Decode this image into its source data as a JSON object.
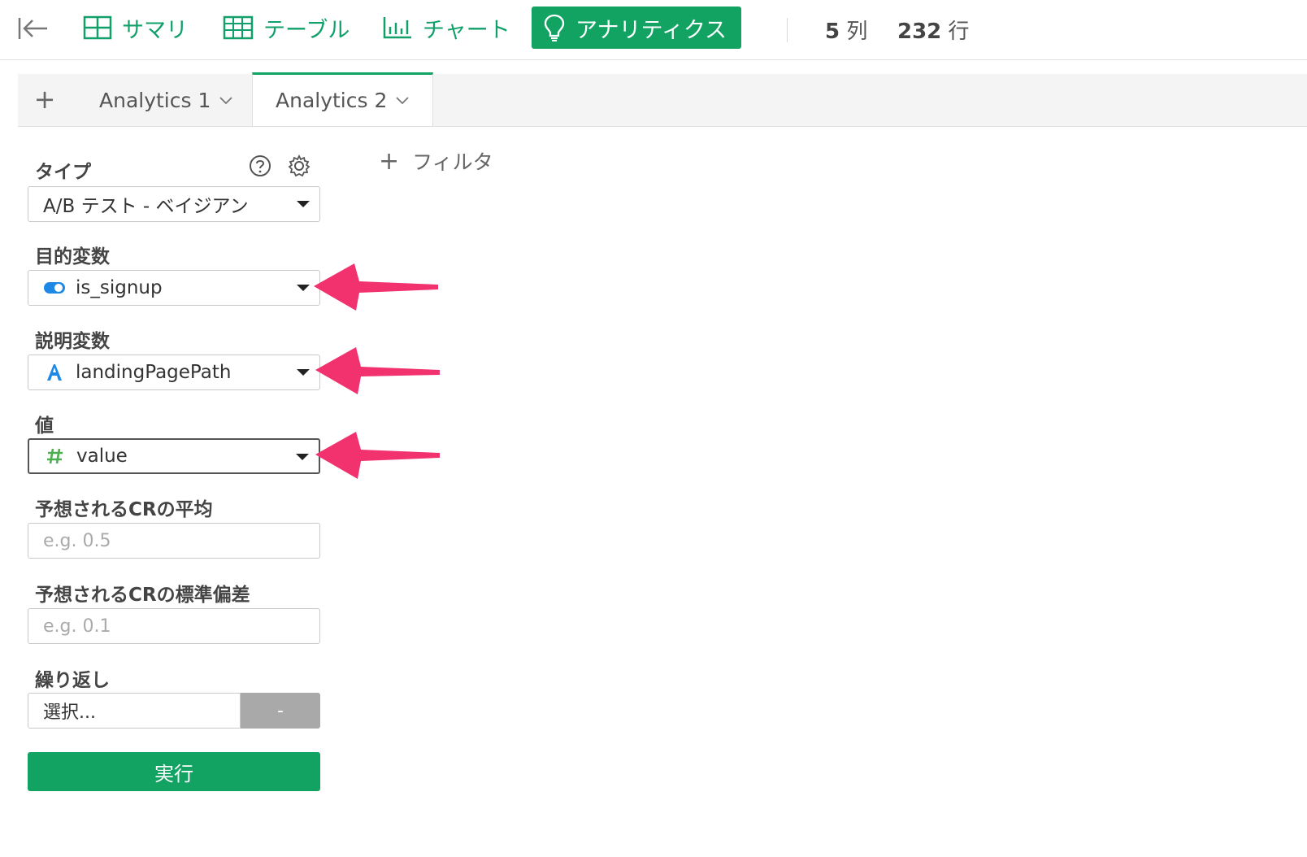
{
  "toolbar": {
    "nav": [
      {
        "label": "サマリ",
        "icon": "summary-grid-icon"
      },
      {
        "label": "テーブル",
        "icon": "table-icon"
      },
      {
        "label": "チャート",
        "icon": "chart-icon"
      },
      {
        "label": "アナリティクス",
        "icon": "lightbulb-icon",
        "active": true
      }
    ],
    "columns_count": "5",
    "columns_unit": "列",
    "rows_count": "232",
    "rows_unit": "行"
  },
  "tabs": {
    "add": "+",
    "items": [
      {
        "label": "Analytics 1",
        "active": false
      },
      {
        "label": "Analytics 2",
        "active": true
      }
    ]
  },
  "panel": {
    "type_label": "タイプ",
    "type_value": "A/B テスト - ベイジアン",
    "target_label": "目的変数",
    "target_value": "is_signup",
    "explanatory_label": "説明変数",
    "explanatory_value": "landingPagePath",
    "value_label": "値",
    "value_value": "value",
    "mean_label": "予想されるCRの平均",
    "mean_placeholder": "e.g. 0.5",
    "sd_label": "予想されるCRの標準偏差",
    "sd_placeholder": "e.g. 0.1",
    "repeat_label": "繰り返し",
    "repeat_value": "選択...",
    "repeat_button": "-",
    "run_button": "実行"
  },
  "filter": {
    "plus": "+",
    "label": "フィルタ"
  },
  "colors": {
    "accent": "#12a363",
    "arrow": "#f2316f",
    "boolean": "#1e88e5",
    "number": "#4caf50"
  }
}
